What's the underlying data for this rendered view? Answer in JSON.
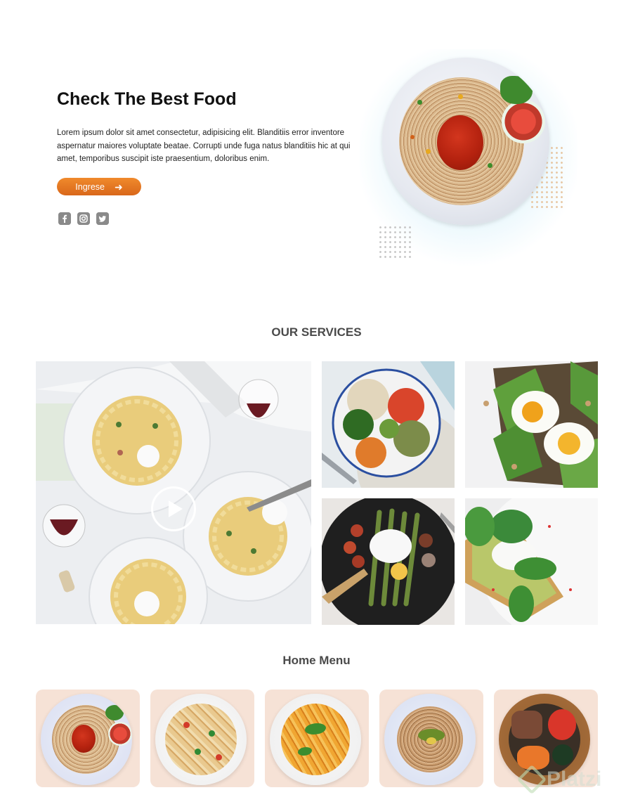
{
  "hero": {
    "title": "Check The Best Food",
    "text": "Lorem ipsum dolor sit amet consectetur, adipisicing elit. Blanditiis error inventore aspernatur maiores voluptate beatae. Corrupti unde fuga natus blanditiis hic at qui amet, temporibus suscipit iste praesentium, doloribus enim.",
    "cta_label": "Ingrese",
    "cta_icon": "arrow-right-icon",
    "socials": [
      "facebook-icon",
      "instagram-icon",
      "twitter-icon"
    ]
  },
  "services": {
    "title": "OUR SERVICES",
    "play_icon": "play-icon"
  },
  "home_menu": {
    "title": "Home Menu",
    "items": [
      "spaghetti-bolognese",
      "penne-salad",
      "fusilli-pasta",
      "noodles-avocado",
      "poke-bowl"
    ]
  },
  "watermark": "Platzi",
  "colors": {
    "accent": "#e57a24",
    "card_bg": "#f6e2d6",
    "heading": "#4a4a4a",
    "social_gray": "#8a8a8a"
  }
}
